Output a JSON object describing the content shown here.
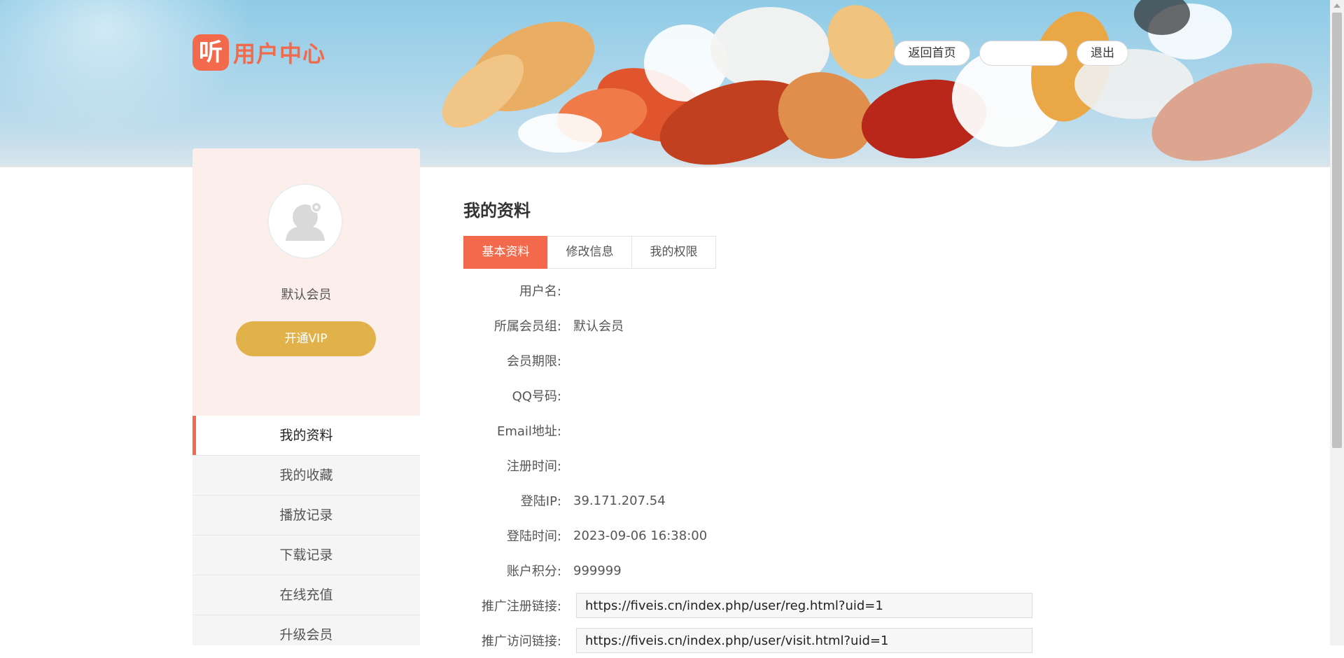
{
  "header": {
    "logo_badge": "听",
    "logo_text": "用户中心",
    "home_label": "返回首页",
    "blank_label": "",
    "logout_label": "退出"
  },
  "sidebar": {
    "member_level": "默认会员",
    "vip_label": "开通VIP",
    "menu": [
      {
        "label": "我的资料",
        "active": true
      },
      {
        "label": "我的收藏"
      },
      {
        "label": "播放记录"
      },
      {
        "label": "下载记录"
      },
      {
        "label": "在线充值"
      },
      {
        "label": "升级会员"
      }
    ]
  },
  "main": {
    "title": "我的资料",
    "tabs": [
      {
        "label": "基本资料",
        "active": true
      },
      {
        "label": "修改信息"
      },
      {
        "label": "我的权限"
      }
    ],
    "rows": [
      {
        "label": "用户名:",
        "value": ""
      },
      {
        "label": "所属会员组:",
        "value": "默认会员"
      },
      {
        "label": "会员期限:",
        "value": ""
      },
      {
        "label": "QQ号码:",
        "value": ""
      },
      {
        "label": "Email地址:",
        "value": ""
      },
      {
        "label": "注册时间:",
        "value": ""
      },
      {
        "label": "登陆IP:",
        "value": "39.171.207.54"
      },
      {
        "label": "登陆时间:",
        "value": "2023-09-06 16:38:00"
      },
      {
        "label": "账户积分:",
        "value": "999999"
      }
    ],
    "links": [
      {
        "label": "推广注册链接:",
        "value": "https://fiveis.cn/index.php/user/reg.html?uid=1"
      },
      {
        "label": "推广访问链接:",
        "value": "https://fiveis.cn/index.php/user/visit.html?uid=1"
      }
    ]
  },
  "colors": {
    "accent": "#f26a4b",
    "vip": "#e2b24a",
    "sidebar_bg": "#fcefeb"
  }
}
